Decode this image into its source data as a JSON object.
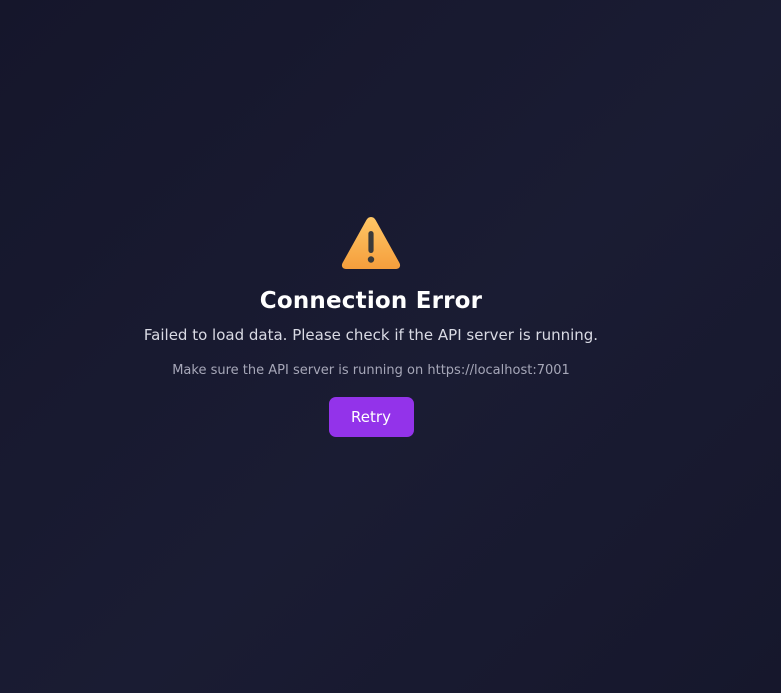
{
  "error": {
    "icon": "warning-triangle-icon",
    "title": "Connection Error",
    "message": "Failed to load data. Please check if the API server is running.",
    "hint": "Make sure the API server is running on https://localhost:7001",
    "retry_label": "Retry"
  },
  "colors": {
    "background": "#17182e",
    "accent": "#9333ea",
    "warning": "#f5a742"
  }
}
